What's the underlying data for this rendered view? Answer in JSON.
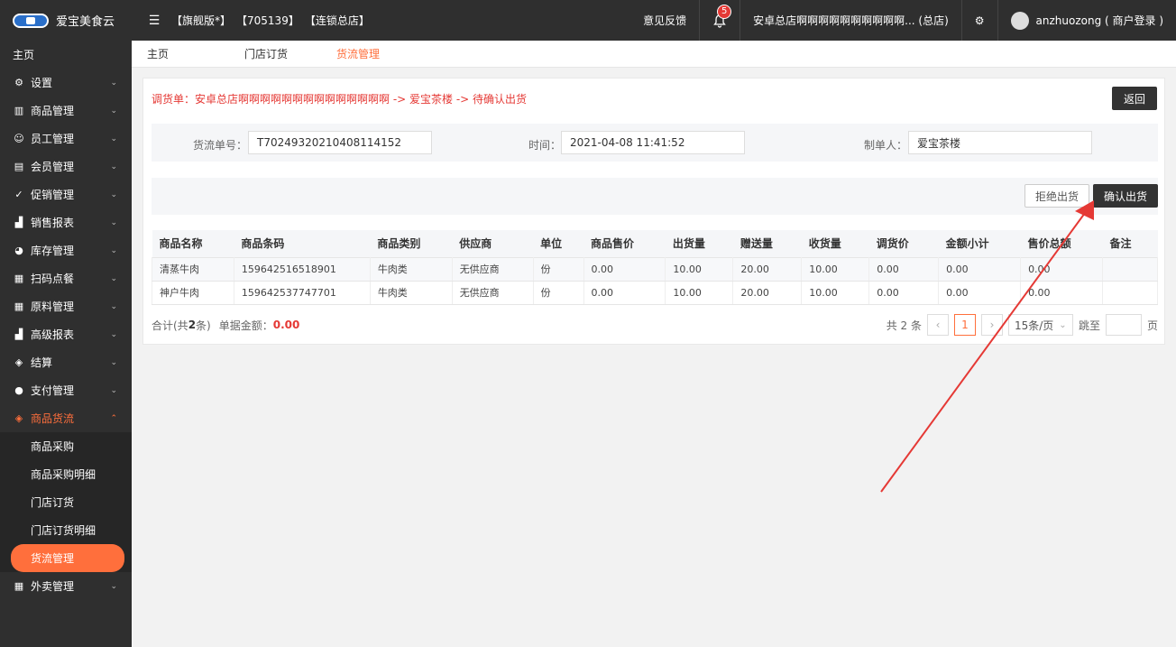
{
  "topbar": {
    "brand": "爱宝美食云",
    "tag_edition": "【旗舰版*】",
    "tag_id": "【705139】",
    "tag_store": "【连锁总店】",
    "feedback": "意见反馈",
    "notification_count": "5",
    "store_name": "安卓总店啊啊啊啊啊啊啊啊啊啊... (总店)",
    "user": "anzhuozong ( 商户登录 )"
  },
  "sidebar": {
    "home": "主页",
    "items": [
      {
        "label": "设置",
        "icon": "gear-icon"
      },
      {
        "label": "商品管理",
        "icon": "barcode-icon"
      },
      {
        "label": "员工管理",
        "icon": "users-icon"
      },
      {
        "label": "会员管理",
        "icon": "card-icon"
      },
      {
        "label": "促销管理",
        "icon": "check-circle-icon"
      },
      {
        "label": "销售报表",
        "icon": "chart-icon"
      },
      {
        "label": "库存管理",
        "icon": "pie-icon"
      },
      {
        "label": "扫码点餐",
        "icon": "store-icon"
      },
      {
        "label": "原料管理",
        "icon": "store-icon"
      },
      {
        "label": "高级报表",
        "icon": "chart-icon"
      },
      {
        "label": "结算",
        "icon": "settle-icon"
      },
      {
        "label": "支付管理",
        "icon": "pay-icon"
      }
    ],
    "active_group": "商品货流",
    "sub_items": [
      "商品采购",
      "商品采购明细",
      "门店订货",
      "门店订货明细",
      "货流管理"
    ],
    "last_item": "外卖管理"
  },
  "tabs": [
    "主页",
    "门店订货",
    "货流管理"
  ],
  "route": "调货单：安卓总店啊啊啊啊啊啊啊啊啊啊啊啊啊啊 -> 爱宝茶楼 -> 待确认出货",
  "back_label": "返回",
  "info": {
    "order_label": "货流单号：",
    "order_no": "T70249320210408114152",
    "time_label": "时间：",
    "time": "2021-04-08 11:41:52",
    "maker_label": "制单人：",
    "maker": "爱宝茶楼"
  },
  "actions": {
    "reject": "拒绝出货",
    "confirm": "确认出货"
  },
  "table": {
    "headers": [
      "商品名称",
      "商品条码",
      "商品类别",
      "供应商",
      "单位",
      "商品售价",
      "出货量",
      "赠送量",
      "收货量",
      "调货价",
      "金额小计",
      "售价总额",
      "备注"
    ],
    "rows": [
      [
        "清蒸牛肉",
        "159642516518901",
        "牛肉类",
        "无供应商",
        "份",
        "0.00",
        "10.00",
        "20.00",
        "10.00",
        "0.00",
        "0.00",
        "0.00",
        ""
      ],
      [
        "神户牛肉",
        "159642537747701",
        "牛肉类",
        "无供应商",
        "份",
        "0.00",
        "10.00",
        "20.00",
        "10.00",
        "0.00",
        "0.00",
        "0.00",
        ""
      ]
    ]
  },
  "footer": {
    "total_prefix": "合计(共",
    "total_count": "2",
    "total_suffix": "条)",
    "amount_label": "单据金额：",
    "amount": "0.00",
    "pager_total": "共 2 条",
    "current_page": "1",
    "page_size": "15条/页",
    "jump_label": "跳至",
    "page_unit": "页"
  },
  "colors": {
    "accent": "#ff6f3c",
    "dark": "#2f2f2f",
    "route_red": "#e53935",
    "arrow_red": "#e53935"
  }
}
